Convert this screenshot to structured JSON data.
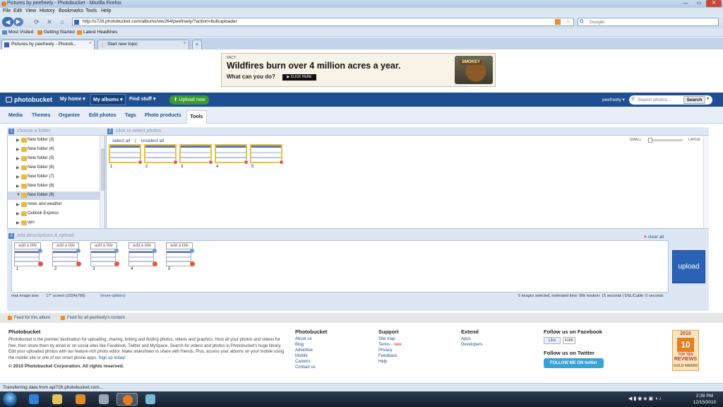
{
  "window": {
    "title": "Pictures by peefreely - Photobucket - Mozilla Firefox",
    "minimize": "—",
    "maximize": "▭",
    "close": "✕"
  },
  "menu": [
    "File",
    "Edit",
    "View",
    "History",
    "Bookmarks",
    "Tools",
    "Help"
  ],
  "nav": {
    "url": "http://s726.photobucket.com/albums/ww264/peefreely/?action=bulkuploader",
    "search_placeholder": "Google"
  },
  "bookmarks": [
    "Most Visited",
    "Getting Started",
    "Latest Headlines"
  ],
  "tabs": [
    {
      "label": "Pictures by peefreely - Photob...",
      "close": "×"
    },
    {
      "label": "Start new topic",
      "close": "×"
    }
  ],
  "new_tab": "+",
  "ad": {
    "tag": "FACT:",
    "headline": "Wildfires burn over 4 million acres a year.",
    "question": "What can you do?",
    "cta": "▶ CLICK HERE",
    "mascot": "SMOKEY"
  },
  "header": {
    "logo": "photobucket",
    "nav": [
      "My home ▾",
      "My albums ▾",
      "Find stuff ▾"
    ],
    "upload_button": "⬆ Upload now",
    "user": "peefreely ▾",
    "search_placeholder": "Search photos...",
    "search_button": "Search",
    "dropdown": "▾"
  },
  "subnav": [
    "Media",
    "Themes",
    "Organize",
    "Edit photos",
    "Tags",
    "Photo products",
    "Tools"
  ],
  "step1": {
    "num": "1",
    "label": "choose a folder"
  },
  "step2": {
    "num": "2",
    "label": "click to select photos"
  },
  "step3": {
    "num": "3",
    "label": "add descriptions & upload"
  },
  "folders": [
    {
      "label": "New folder (3)",
      "tri": "▶"
    },
    {
      "label": "New folder (4)",
      "tri": "▶"
    },
    {
      "label": "New folder (5)",
      "tri": "▶"
    },
    {
      "label": "New folder (6)",
      "tri": "▶"
    },
    {
      "label": "New folder (7)",
      "tri": "▶"
    },
    {
      "label": "New folder (8)",
      "tri": "▶"
    },
    {
      "label": "New folder (9)",
      "tri": "▼"
    },
    {
      "label": "news and weather",
      "tri": "▶"
    },
    {
      "label": "Outlook Express",
      "tri": "▶"
    },
    {
      "label": "vpn",
      "tri": "▶"
    }
  ],
  "photos": {
    "select_all": "select all",
    "separator": "|",
    "unselect_all": "unselect all",
    "small": "SMALL",
    "large": "LARGE",
    "numbers": [
      "1",
      "2",
      "3",
      "4",
      "5"
    ]
  },
  "descriptions": {
    "title_placeholder": "add a title",
    "clear_all": "clear all",
    "clear_icon": "×",
    "numbers": [
      "1",
      "2",
      "3",
      "4",
      "5"
    ],
    "upload": "upload",
    "max_size_label": "max image size:",
    "max_size_value": "17\" screen (1024x768)",
    "more_options": "(more options)",
    "estimate": "5 images selected, estimated time: 56k modem: 15 seconds | DSL/Cable: 0 seconds"
  },
  "feeds": [
    "Feed for this album",
    "Feed for all peefreely's content"
  ],
  "footer": {
    "about_title": "Photobucket",
    "about_text": "Photobucket is the premier destination for uploading, sharing, linking and finding photos, videos and graphics. Host all your photos and videos for free, then share them by email or on social sites like Facebook, Twitter and MySpace. Search for videos and photos in Photobucket's huge library. Edit your uploaded photos with our feature-rich photo editor. Make slideshows to share with friends. Plus, access your albums on your mobile using the mobile site or one of our smart phone apps.",
    "signup": "Sign up today!",
    "copyright": "© 2010 Photobucket Corporation. All rights reserved.",
    "col_photobucket": {
      "title": "Photobucket",
      "links": [
        "About us",
        "Blog",
        "Advertise",
        "Mobile",
        "Careers",
        "Contact us"
      ]
    },
    "col_support": {
      "title": "Support",
      "links": [
        "Site map",
        "Terms -",
        "Privacy",
        "Feedback",
        "Help"
      ],
      "new": "new"
    },
    "col_extend": {
      "title": "Extend",
      "links": [
        "Apps",
        "Developers"
      ]
    },
    "facebook_title": "Follow us on Facebook",
    "like": "Like",
    "like_count": "418K",
    "twitter_title": "Follow us on Twitter",
    "twitter_btn": "FOLLOW ME ON twitter",
    "award": {
      "year": "2010",
      "ten": "10",
      "top": "TOP TEN",
      "reviews": "REVIEWS",
      "gold": "GOLD AWARD"
    }
  },
  "status": "Transferring data from api726.photobucket.com...",
  "clock": {
    "time": "2:38 PM",
    "date": "12/15/2010"
  }
}
